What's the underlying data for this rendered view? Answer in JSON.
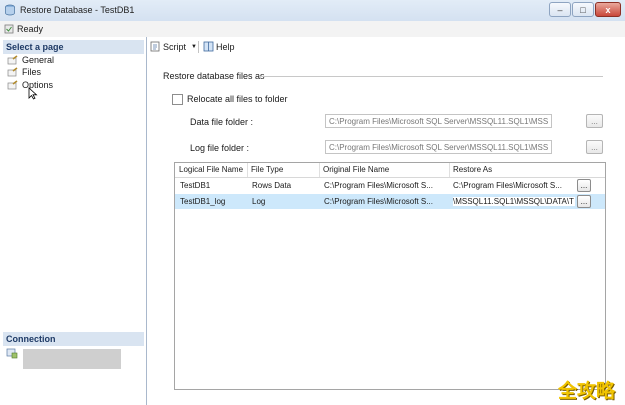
{
  "window": {
    "title": "Restore Database - TestDB1",
    "min": "–",
    "max": "□",
    "close": "x"
  },
  "status": {
    "text": "Ready"
  },
  "sidebar": {
    "header": "Select a page",
    "items": [
      {
        "label": "General"
      },
      {
        "label": "Files"
      },
      {
        "label": "Options"
      }
    ],
    "connection_header": "Connection"
  },
  "toolbar": {
    "script_label": "Script",
    "help_label": "Help"
  },
  "main": {
    "section_title": "Restore database files as",
    "relocate_label": "Relocate all files to folder",
    "relocate_checked": false,
    "data_folder_label": "Data file folder :",
    "data_folder_value": "C:\\Program Files\\Microsoft SQL Server\\MSSQL11.SQL1\\MSS",
    "log_folder_label": "Log file folder :",
    "log_folder_value": "C:\\Program Files\\Microsoft SQL Server\\MSSQL11.SQL1\\MSS",
    "browse_label": "..."
  },
  "grid": {
    "columns": [
      "Logical File Name",
      "File Type",
      "Original File Name",
      "Restore As"
    ],
    "rows": [
      {
        "logical": "TestDB1",
        "type": "Rows Data",
        "original": "C:\\Program Files\\Microsoft S...",
        "restore": "C:\\Program Files\\Microsoft S...",
        "selected": false
      },
      {
        "logical": "TestDB1_log",
        "type": "Log",
        "original": "C:\\Program Files\\Microsoft S...",
        "restore": "\\MSSQL11.SQL1\\MSSQL\\DATA\\T",
        "selected": true
      }
    ]
  },
  "watermark": "全攻略",
  "colors": {
    "header_bg": "#d9e4f1",
    "selected_row": "#cde8fb",
    "watermark": "#f1c400"
  }
}
